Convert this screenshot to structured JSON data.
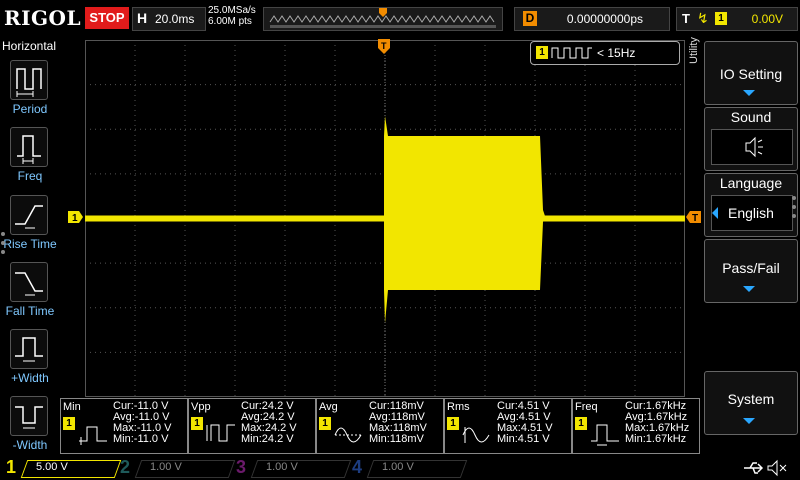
{
  "brand": "RIGOL",
  "run_state": "STOP",
  "horizontal": {
    "label": "H",
    "timebase": "20.0ms"
  },
  "sampling": {
    "rate": "25.0MSa/s",
    "points": "6.00M pts"
  },
  "delay": {
    "label": "D",
    "value": "0.00000000ps"
  },
  "trigger": {
    "label": "T",
    "source": "1",
    "level": "0.00V"
  },
  "left_menu": {
    "title": "Horizontal",
    "items": [
      {
        "label": "Period",
        "icon": "period-icon"
      },
      {
        "label": "Freq",
        "icon": "freq-icon"
      },
      {
        "label": "Rise Time",
        "icon": "rise-time-icon"
      },
      {
        "label": "Fall Time",
        "icon": "fall-time-icon"
      },
      {
        "label": "+Width",
        "icon": "positive-width-icon"
      },
      {
        "label": "-Width",
        "icon": "negative-width-icon"
      }
    ]
  },
  "freq_counter": {
    "channel": "1",
    "value": "< 15Hz"
  },
  "right_menu": {
    "tab_label": "Utility",
    "io_setting": "IO Setting",
    "sound": "Sound",
    "language_title": "Language",
    "language_value": "English",
    "pass_fail": "Pass/Fail",
    "system": "System"
  },
  "measurements": [
    {
      "name": "Min",
      "cur": "Cur:-11.0 V",
      "avg": "Avg:-11.0 V",
      "max": "Max:-11.0 V",
      "min": "Min:-11.0 V"
    },
    {
      "name": "Vpp",
      "cur": "Cur:24.2 V",
      "avg": "Avg:24.2 V",
      "max": "Max:24.2 V",
      "min": "Min:24.2 V"
    },
    {
      "name": "Avg",
      "cur": "Cur:118mV",
      "avg": "Avg:118mV",
      "max": "Max:118mV",
      "min": "Min:118mV"
    },
    {
      "name": "Rms",
      "cur": "Cur:4.51 V",
      "avg": "Avg:4.51 V",
      "max": "Max:4.51 V",
      "min": "Min:4.51 V"
    },
    {
      "name": "Freq",
      "cur": "Cur:1.67kHz",
      "avg": "Avg:1.67kHz",
      "max": "Max:1.67kHz",
      "min": "Min:1.67kHz"
    }
  ],
  "meas_badge": "1",
  "channels": [
    {
      "num": "1",
      "scale": "5.00 V",
      "color": "#f2e600",
      "active": true
    },
    {
      "num": "2",
      "scale": "1.00 V",
      "color": "#1fd0d0",
      "active": false
    },
    {
      "num": "3",
      "scale": "1.00 V",
      "color": "#e020e0",
      "active": false
    },
    {
      "num": "4",
      "scale": "1.00 V",
      "color": "#3a7bff",
      "active": false
    }
  ],
  "markers": {
    "ch1": "1",
    "trigger": "T"
  },
  "colors": {
    "ch1": "#f2e600",
    "trigger": "#f28c00",
    "menu_accent": "#2aa7ff",
    "stop": "#e11b1b"
  }
}
